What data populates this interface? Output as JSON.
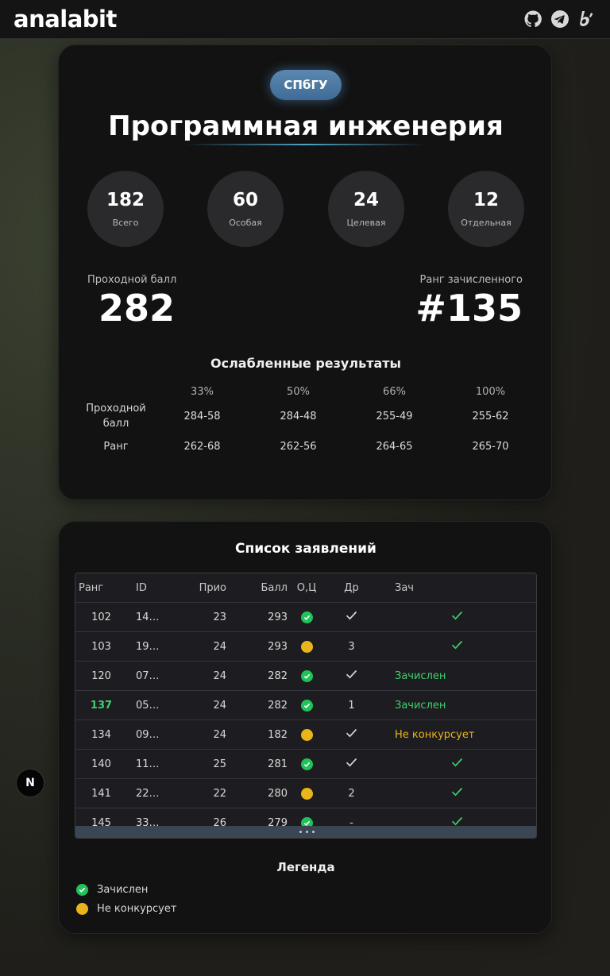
{
  "header": {
    "logo": "analabit",
    "icons": [
      "github-icon",
      "telegram-icon",
      "b-brand-icon"
    ]
  },
  "program": {
    "university": "СПбГУ",
    "title": "Программная инженерия",
    "stats": [
      {
        "value": "182",
        "label": "Всего"
      },
      {
        "value": "60",
        "label": "Особая"
      },
      {
        "value": "24",
        "label": "Целевая"
      },
      {
        "value": "12",
        "label": "Отдельная"
      }
    ],
    "pass_label": "Проходной балл",
    "pass_value": "282",
    "rank_label": "Ранг зачисленного",
    "rank_value": "#135"
  },
  "weakened": {
    "title": "Ослабленные результаты",
    "columns": [
      "33%",
      "50%",
      "66%",
      "100%"
    ],
    "rows": [
      {
        "label": "Проходной балл",
        "values": [
          "284-58",
          "284-48",
          "255-49",
          "255-62"
        ]
      },
      {
        "label": "Ранг",
        "values": [
          "262-68",
          "262-56",
          "264-65",
          "265-70"
        ]
      }
    ]
  },
  "applications": {
    "title": "Список заявлений",
    "headers": {
      "rank": "Ранг",
      "id": "ID",
      "prio": "Прио",
      "ball": "Балл",
      "oc": "О,Ц",
      "dr": "Др",
      "zach": "Зач"
    },
    "rows": [
      {
        "rank": "102",
        "id": "14…",
        "prio": "23",
        "ball": "293",
        "oc": "green",
        "dr": "check",
        "zach": "check"
      },
      {
        "rank": "103",
        "id": "19…",
        "prio": "24",
        "ball": "293",
        "oc": "yellow",
        "dr": "3",
        "zach": "check"
      },
      {
        "rank": "120",
        "id": "07…",
        "prio": "24",
        "ball": "282",
        "oc": "green",
        "dr": "check",
        "zach": "Зачислен"
      },
      {
        "rank": "137",
        "id": "05…",
        "prio": "24",
        "ball": "282",
        "oc": "green",
        "dr": "1",
        "zach": "Зачислен",
        "highlight": true
      },
      {
        "rank": "134",
        "id": "09…",
        "prio": "24",
        "ball": "182",
        "oc": "yellow",
        "dr": "check",
        "zach": "Не конкурсует"
      },
      {
        "rank": "140",
        "id": "11…",
        "prio": "25",
        "ball": "281",
        "oc": "green",
        "dr": "check",
        "zach": "check"
      },
      {
        "rank": "141",
        "id": "22…",
        "prio": "22",
        "ball": "280",
        "oc": "yellow",
        "dr": "2",
        "zach": "check"
      },
      {
        "rank": "145",
        "id": "33…",
        "prio": "26",
        "ball": "279",
        "oc": "green",
        "dr": "-",
        "zach": "check"
      }
    ]
  },
  "legend": {
    "title": "Легенда",
    "items": [
      {
        "label": "Зачислен",
        "color": "#22c25a"
      },
      {
        "label": "Не конкурсует",
        "color": "#e8b51a"
      }
    ]
  },
  "floating_badge": "N",
  "colors": {
    "green": "#3fcf6c",
    "yellow": "#e8b51a",
    "badge": "#4a78a3"
  }
}
